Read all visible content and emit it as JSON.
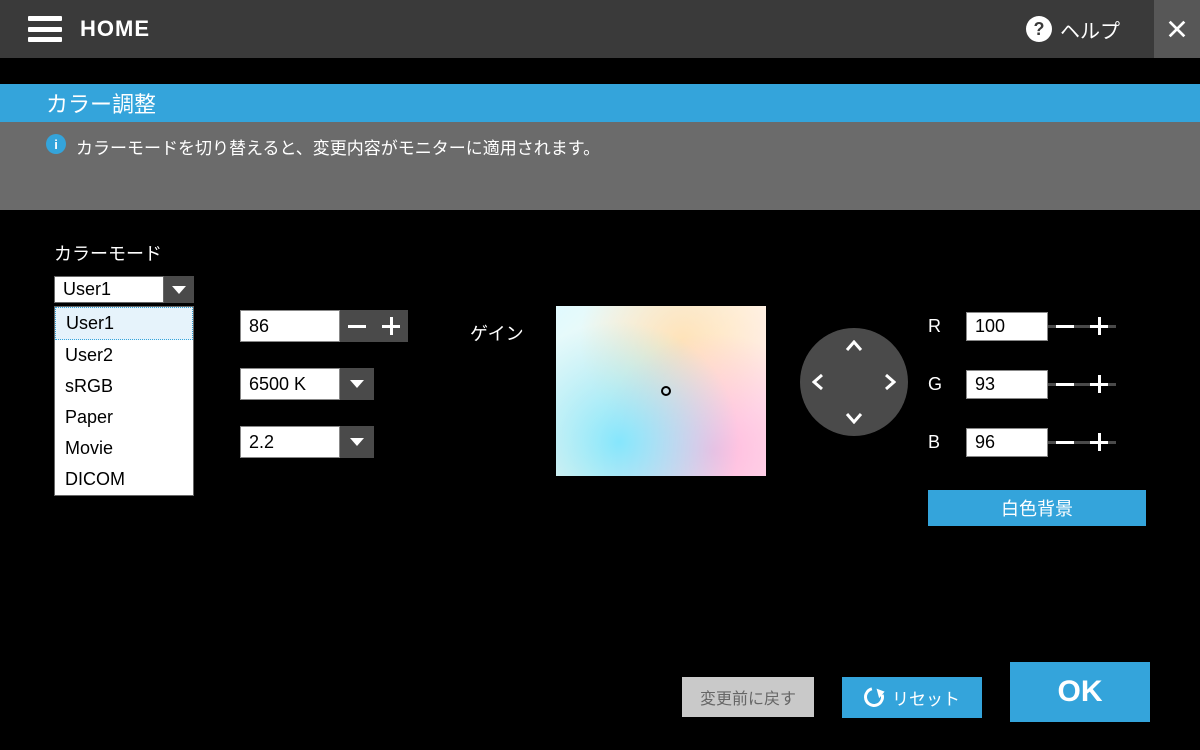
{
  "topbar": {
    "home": "HOME",
    "help": "ヘルプ"
  },
  "title": "カラー調整",
  "info": "カラーモードを切り替えると、変更内容がモニターに適用されます。",
  "color_mode": {
    "label": "カラーモード",
    "value": "User1",
    "options": [
      "User1",
      "User2",
      "sRGB",
      "Paper",
      "Movie",
      "DICOM"
    ]
  },
  "brightness": {
    "value": "86"
  },
  "color_temp": {
    "value": "6500 K"
  },
  "gamma": {
    "value": "2.2"
  },
  "gain": {
    "label": "ゲイン",
    "r_label": "R",
    "g_label": "G",
    "b_label": "B",
    "r": "100",
    "g": "93",
    "b": "96"
  },
  "white_bg_btn": "白色背景",
  "buttons": {
    "revert": "変更前に戻す",
    "reset": "リセット",
    "ok": "OK"
  },
  "colors": {
    "accent": "#34a4db",
    "grey_dark": "#3a3a3a",
    "grey_mid": "#6b6b6b",
    "grey_btn": "#4a4a4a"
  }
}
